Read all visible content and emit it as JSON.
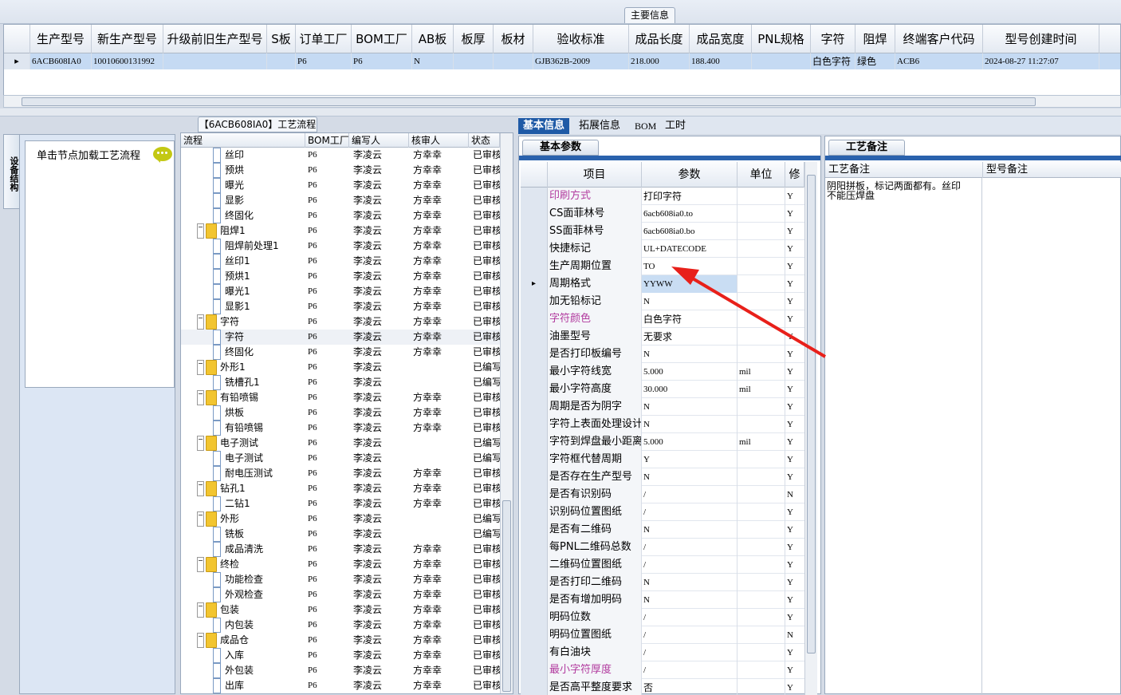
{
  "top": {
    "title": "主要信息",
    "headers": [
      "生产型号",
      "新生产型号",
      "升级前旧生产型号",
      "S板",
      "订单工厂",
      "BOM工厂",
      "AB板",
      "板厚",
      "板材",
      "验收标准",
      "成品长度",
      "成品宽度",
      "PNL规格",
      "字符",
      "阻焊",
      "终端客户代码",
      "型号创建时间"
    ],
    "row": [
      "6ACB608IA0",
      "10010600131992",
      "",
      "",
      "P6",
      "P6",
      "N",
      "",
      "",
      "GJB362B-2009",
      "218.000",
      "188.400",
      "",
      "白色字符",
      "绿色",
      "ACB6",
      "2024-08-27 11:27:07"
    ]
  },
  "left": {
    "vtab": "设备结构",
    "hint": "单击节点加载工艺流程"
  },
  "flow": {
    "tab_title": "【6ACB608IA0】工艺流程",
    "headers": [
      "流程",
      "BOM工厂",
      "编写人",
      "核审人",
      "状态"
    ],
    "rows": [
      {
        "level": 2,
        "type": "leaf",
        "name": "丝印",
        "bom": "P6",
        "writer": "李凌云",
        "checker": "方幸幸",
        "status": "已审核"
      },
      {
        "level": 2,
        "type": "leaf",
        "name": "预烘",
        "bom": "P6",
        "writer": "李凌云",
        "checker": "方幸幸",
        "status": "已审核"
      },
      {
        "level": 2,
        "type": "leaf",
        "name": "曝光",
        "bom": "P6",
        "writer": "李凌云",
        "checker": "方幸幸",
        "status": "已审核"
      },
      {
        "level": 2,
        "type": "leaf",
        "name": "显影",
        "bom": "P6",
        "writer": "李凌云",
        "checker": "方幸幸",
        "status": "已审核"
      },
      {
        "level": 2,
        "type": "leaf",
        "name": "终固化",
        "bom": "P6",
        "writer": "李凌云",
        "checker": "方幸幸",
        "status": "已审核"
      },
      {
        "level": 1,
        "type": "folder",
        "name": "阻焊1",
        "bom": "P6",
        "writer": "李凌云",
        "checker": "方幸幸",
        "status": "已审核"
      },
      {
        "level": 2,
        "type": "leaf",
        "name": "阻焊前处理1",
        "bom": "P6",
        "writer": "李凌云",
        "checker": "方幸幸",
        "status": "已审核"
      },
      {
        "level": 2,
        "type": "leaf",
        "name": "丝印1",
        "bom": "P6",
        "writer": "李凌云",
        "checker": "方幸幸",
        "status": "已审核"
      },
      {
        "level": 2,
        "type": "leaf",
        "name": "预烘1",
        "bom": "P6",
        "writer": "李凌云",
        "checker": "方幸幸",
        "status": "已审核"
      },
      {
        "level": 2,
        "type": "leaf",
        "name": "曝光1",
        "bom": "P6",
        "writer": "李凌云",
        "checker": "方幸幸",
        "status": "已审核"
      },
      {
        "level": 2,
        "type": "leaf",
        "name": "显影1",
        "bom": "P6",
        "writer": "李凌云",
        "checker": "方幸幸",
        "status": "已审核"
      },
      {
        "level": 1,
        "type": "folder",
        "name": "字符",
        "bom": "P6",
        "writer": "李凌云",
        "checker": "方幸幸",
        "status": "已审核"
      },
      {
        "level": 2,
        "type": "leaf",
        "name": "字符",
        "bom": "P6",
        "writer": "李凌云",
        "checker": "方幸幸",
        "status": "已审核",
        "selected": true
      },
      {
        "level": 2,
        "type": "leaf",
        "name": "终固化",
        "bom": "P6",
        "writer": "李凌云",
        "checker": "方幸幸",
        "status": "已审核"
      },
      {
        "level": 1,
        "type": "folder",
        "name": "外形1",
        "bom": "P6",
        "writer": "李凌云",
        "checker": "",
        "status": "已编写"
      },
      {
        "level": 2,
        "type": "leaf",
        "name": "铣槽孔1",
        "bom": "P6",
        "writer": "李凌云",
        "checker": "",
        "status": "已编写"
      },
      {
        "level": 1,
        "type": "folder",
        "name": "有铅喷锡",
        "bom": "P6",
        "writer": "李凌云",
        "checker": "方幸幸",
        "status": "已审核"
      },
      {
        "level": 2,
        "type": "leaf",
        "name": "烘板",
        "bom": "P6",
        "writer": "李凌云",
        "checker": "方幸幸",
        "status": "已审核"
      },
      {
        "level": 2,
        "type": "leaf",
        "name": "有铅喷锡",
        "bom": "P6",
        "writer": "李凌云",
        "checker": "方幸幸",
        "status": "已审核"
      },
      {
        "level": 1,
        "type": "folder",
        "name": "电子测试",
        "bom": "P6",
        "writer": "李凌云",
        "checker": "",
        "status": "已编写"
      },
      {
        "level": 2,
        "type": "leaf",
        "name": "电子测试",
        "bom": "P6",
        "writer": "李凌云",
        "checker": "",
        "status": "已编写"
      },
      {
        "level": 2,
        "type": "leaf",
        "name": "耐电压测试",
        "bom": "P6",
        "writer": "李凌云",
        "checker": "方幸幸",
        "status": "已审核"
      },
      {
        "level": 1,
        "type": "folder",
        "name": "钻孔1",
        "bom": "P6",
        "writer": "李凌云",
        "checker": "方幸幸",
        "status": "已审核"
      },
      {
        "level": 2,
        "type": "leaf",
        "name": "二钻1",
        "bom": "P6",
        "writer": "李凌云",
        "checker": "方幸幸",
        "status": "已审核"
      },
      {
        "level": 1,
        "type": "folder",
        "name": "外形",
        "bom": "P6",
        "writer": "李凌云",
        "checker": "",
        "status": "已编写"
      },
      {
        "level": 2,
        "type": "leaf",
        "name": "铣板",
        "bom": "P6",
        "writer": "李凌云",
        "checker": "",
        "status": "已编写"
      },
      {
        "level": 2,
        "type": "leaf",
        "name": "成品清洗",
        "bom": "P6",
        "writer": "李凌云",
        "checker": "方幸幸",
        "status": "已审核"
      },
      {
        "level": 1,
        "type": "folder",
        "name": "终检",
        "bom": "P6",
        "writer": "李凌云",
        "checker": "方幸幸",
        "status": "已审核"
      },
      {
        "level": 2,
        "type": "leaf",
        "name": "功能检查",
        "bom": "P6",
        "writer": "李凌云",
        "checker": "方幸幸",
        "status": "已审核"
      },
      {
        "level": 2,
        "type": "leaf",
        "name": "外观检查",
        "bom": "P6",
        "writer": "李凌云",
        "checker": "方幸幸",
        "status": "已审核"
      },
      {
        "level": 1,
        "type": "folder",
        "name": "包装",
        "bom": "P6",
        "writer": "李凌云",
        "checker": "方幸幸",
        "status": "已审核"
      },
      {
        "level": 2,
        "type": "leaf",
        "name": "内包装",
        "bom": "P6",
        "writer": "李凌云",
        "checker": "方幸幸",
        "status": "已审核"
      },
      {
        "level": 1,
        "type": "folder",
        "name": "成品仓",
        "bom": "P6",
        "writer": "李凌云",
        "checker": "方幸幸",
        "status": "已审核"
      },
      {
        "level": 2,
        "type": "leaf",
        "name": "入库",
        "bom": "P6",
        "writer": "李凌云",
        "checker": "方幸幸",
        "status": "已审核"
      },
      {
        "level": 2,
        "type": "leaf",
        "name": "外包装",
        "bom": "P6",
        "writer": "李凌云",
        "checker": "方幸幸",
        "status": "已审核"
      },
      {
        "level": 2,
        "type": "leaf",
        "name": "出库",
        "bom": "P6",
        "writer": "李凌云",
        "checker": "方幸幸",
        "status": "已审核"
      }
    ]
  },
  "tabs": [
    "基本信息",
    "拓展信息",
    "BOM",
    "工时"
  ],
  "basic": {
    "title": "基本参数",
    "headers": [
      "项目",
      "参数",
      "单位",
      "修"
    ],
    "rows": [
      {
        "item": "印刷方式",
        "value": "打印字符",
        "unit": "",
        "flag": "Y",
        "pink": true
      },
      {
        "item": "CS面菲林号",
        "value": "6acb608ia0.to",
        "unit": "",
        "flag": "Y"
      },
      {
        "item": "SS面菲林号",
        "value": "6acb608ia0.bo",
        "unit": "",
        "flag": "Y"
      },
      {
        "item": "快捷标记",
        "value": "UL+DATECODE",
        "unit": "",
        "flag": "Y"
      },
      {
        "item": "生产周期位置",
        "value": "TO",
        "unit": "",
        "flag": "Y"
      },
      {
        "item": "周期格式",
        "value": "YYWW",
        "unit": "",
        "flag": "Y",
        "current": true
      },
      {
        "item": "加无铅标记",
        "value": "N",
        "unit": "",
        "flag": "Y"
      },
      {
        "item": "字符颜色",
        "value": "白色字符",
        "unit": "",
        "flag": "Y",
        "pink": true
      },
      {
        "item": "油墨型号",
        "value": "无要求",
        "unit": "",
        "flag": "Y"
      },
      {
        "item": "是否打印板编号",
        "value": "N",
        "unit": "",
        "flag": "Y"
      },
      {
        "item": "最小字符线宽",
        "value": "5.000",
        "unit": "mil",
        "flag": "Y"
      },
      {
        "item": "最小字符高度",
        "value": "30.000",
        "unit": "mil",
        "flag": "Y"
      },
      {
        "item": "周期是否为阴字",
        "value": "N",
        "unit": "",
        "flag": "Y"
      },
      {
        "item": "字符上表面处理设计",
        "value": "N",
        "unit": "",
        "flag": "Y"
      },
      {
        "item": "字符到焊盘最小距离",
        "value": "5.000",
        "unit": "mil",
        "flag": "Y"
      },
      {
        "item": "字符框代替周期",
        "value": "Y",
        "unit": "",
        "flag": "Y"
      },
      {
        "item": "是否存在生产型号",
        "value": "N",
        "unit": "",
        "flag": "Y"
      },
      {
        "item": "是否有识别码",
        "value": "/",
        "unit": "",
        "flag": "N"
      },
      {
        "item": "识别码位置图纸",
        "value": "/",
        "unit": "",
        "flag": "Y"
      },
      {
        "item": "是否有二维码",
        "value": "N",
        "unit": "",
        "flag": "Y"
      },
      {
        "item": "每PNL二维码总数",
        "value": "/",
        "unit": "",
        "flag": "Y"
      },
      {
        "item": "二维码位置图纸",
        "value": "/",
        "unit": "",
        "flag": "Y"
      },
      {
        "item": "是否打印二维码",
        "value": "N",
        "unit": "",
        "flag": "Y"
      },
      {
        "item": "是否有增加明码",
        "value": "N",
        "unit": "",
        "flag": "Y"
      },
      {
        "item": "明码位数",
        "value": "/",
        "unit": "",
        "flag": "Y"
      },
      {
        "item": "明码位置图纸",
        "value": "/",
        "unit": "",
        "flag": "N"
      },
      {
        "item": "有白油块",
        "value": "/",
        "unit": "",
        "flag": "Y"
      },
      {
        "item": "最小字符厚度",
        "value": "/",
        "unit": "",
        "flag": "Y",
        "pink": true
      },
      {
        "item": "是否高平整度要求",
        "value": "否",
        "unit": "",
        "flag": "Y"
      }
    ]
  },
  "remark": {
    "title": "工艺备注",
    "headers": [
      "工艺备注",
      "型号备注"
    ],
    "text": "阴阳拼板，标记两面都有。丝印\n不能压焊盘"
  },
  "colors": {
    "accent": "#1f5aa6",
    "selected_row": "#c5daf3",
    "pink_label": "#b23c9f",
    "annotation_arrow": "#e8201a"
  }
}
